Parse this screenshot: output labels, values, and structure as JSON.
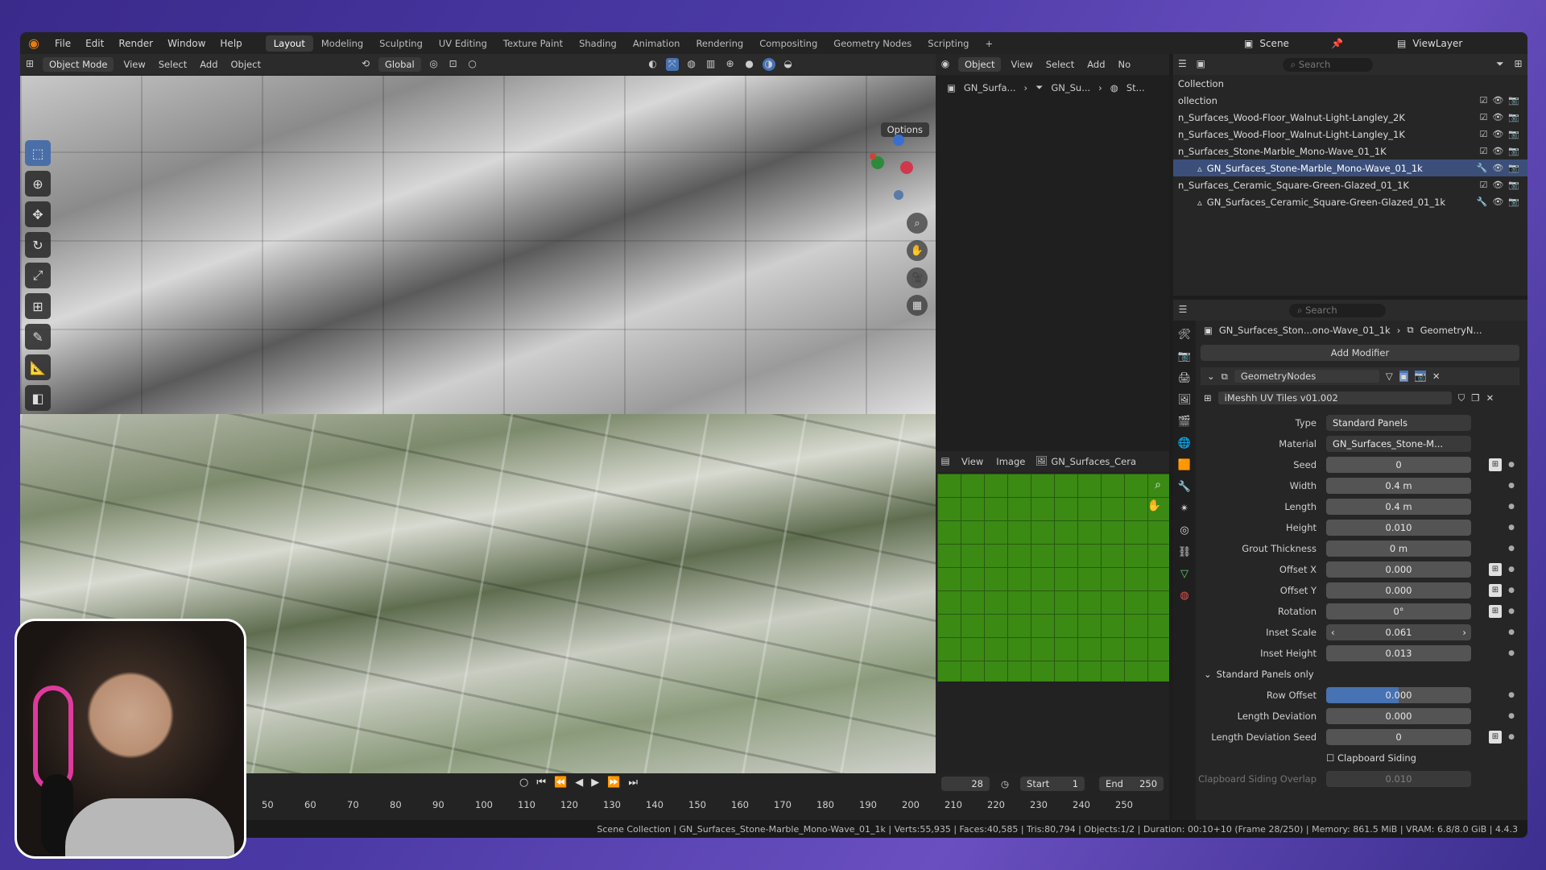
{
  "topbar": {
    "menus": [
      "File",
      "Edit",
      "Render",
      "Window",
      "Help"
    ],
    "workspaces": [
      "Layout",
      "Modeling",
      "Sculpting",
      "UV Editing",
      "Texture Paint",
      "Shading",
      "Animation",
      "Rendering",
      "Compositing",
      "Geometry Nodes",
      "Scripting"
    ],
    "active_workspace": "Layout",
    "plus": "+",
    "scene": "Scene",
    "view_layer": "ViewLayer"
  },
  "viewport_header": {
    "mode": "Object Mode",
    "menus": [
      "View",
      "Select",
      "Add",
      "Object"
    ],
    "transform": "Global",
    "options": "Options"
  },
  "node_header": {
    "mode": "Object",
    "menus": [
      "View",
      "Select",
      "Add",
      "No"
    ],
    "breadcrumb": [
      "GN_Surfa...",
      "GN_Su...",
      "St..."
    ]
  },
  "image_header": {
    "menus": [
      "View",
      "Image"
    ],
    "image_name": "GN_Surfaces_Cera"
  },
  "outliner": {
    "search_placeholder": "Search",
    "items": [
      {
        "label": "Collection"
      },
      {
        "label": "ollection"
      },
      {
        "label": "n_Surfaces_Wood-Floor_Walnut-Light-Langley_2K"
      },
      {
        "label": "n_Surfaces_Wood-Floor_Walnut-Light-Langley_1K"
      },
      {
        "label": "n_Surfaces_Stone-Marble_Mono-Wave_01_1K"
      },
      {
        "label": "GN_Surfaces_Stone-Marble_Mono-Wave_01_1k"
      },
      {
        "label": "n_Surfaces_Ceramic_Square-Green-Glazed_01_1K"
      },
      {
        "label": "GN_Surfaces_Ceramic_Square-Green-Glazed_01_1k"
      }
    ]
  },
  "properties": {
    "search_placeholder": "Search",
    "breadcrumb_object": "GN_Surfaces_Ston...ono-Wave_01_1k",
    "breadcrumb_modifier": "GeometryN...",
    "add_modifier": "Add Modifier",
    "modifier_name": "GeometryNodes",
    "node_group": "iMeshh UV Tiles v01.002",
    "fields": [
      {
        "label": "Type",
        "value": "Standard Panels"
      },
      {
        "label": "Material",
        "value": "GN_Surfaces_Stone-M..."
      },
      {
        "label": "Seed",
        "value": "0"
      },
      {
        "label": "Width",
        "value": "0.4 m"
      },
      {
        "label": "Length",
        "value": "0.4 m"
      },
      {
        "label": "Height",
        "value": "0.010"
      },
      {
        "label": "Grout Thickness",
        "value": "0 m"
      },
      {
        "label": "Offset X",
        "value": "0.000"
      },
      {
        "label": "Offset Y",
        "value": "0.000"
      },
      {
        "label": "Rotation",
        "value": "0°"
      },
      {
        "label": "Inset Scale",
        "value": "0.061"
      },
      {
        "label": "Inset Height",
        "value": "0.013"
      }
    ],
    "panel_title": "Standard Panels only",
    "panel_fields": [
      {
        "label": "Row Offset",
        "value": "0.000"
      },
      {
        "label": "Length Deviation",
        "value": "0.000"
      },
      {
        "label": "Length Deviation Seed",
        "value": "0"
      }
    ],
    "clapboard_siding": "Clapboard Siding",
    "clapboard_overlap_label": "Clapboard Siding Overlap",
    "clapboard_overlap_value": "0.010"
  },
  "timeline": {
    "current_frame": "28",
    "start_label": "Start",
    "start": "1",
    "end_label": "End",
    "end": "250",
    "ticks": [
      "50",
      "60",
      "70",
      "80",
      "90",
      "100",
      "110",
      "120",
      "130",
      "140",
      "150",
      "160",
      "170",
      "180",
      "190",
      "200",
      "210",
      "220",
      "230",
      "240",
      "250"
    ]
  },
  "statusbar": {
    "text": "Scene Collection | GN_Surfaces_Stone-Marble_Mono-Wave_01_1k | Verts:55,935 | Faces:40,585 | Tris:80,794 | Objects:1/2 | Duration: 00:10+10 (Frame 28/250) | Memory: 861.5 MiB | VRAM: 6.8/8.0 GiB | 4.4.3"
  },
  "colors": {
    "accent": "#4772b3",
    "selection": "#3b4f7a",
    "blender_orange": "#e87d0d"
  }
}
